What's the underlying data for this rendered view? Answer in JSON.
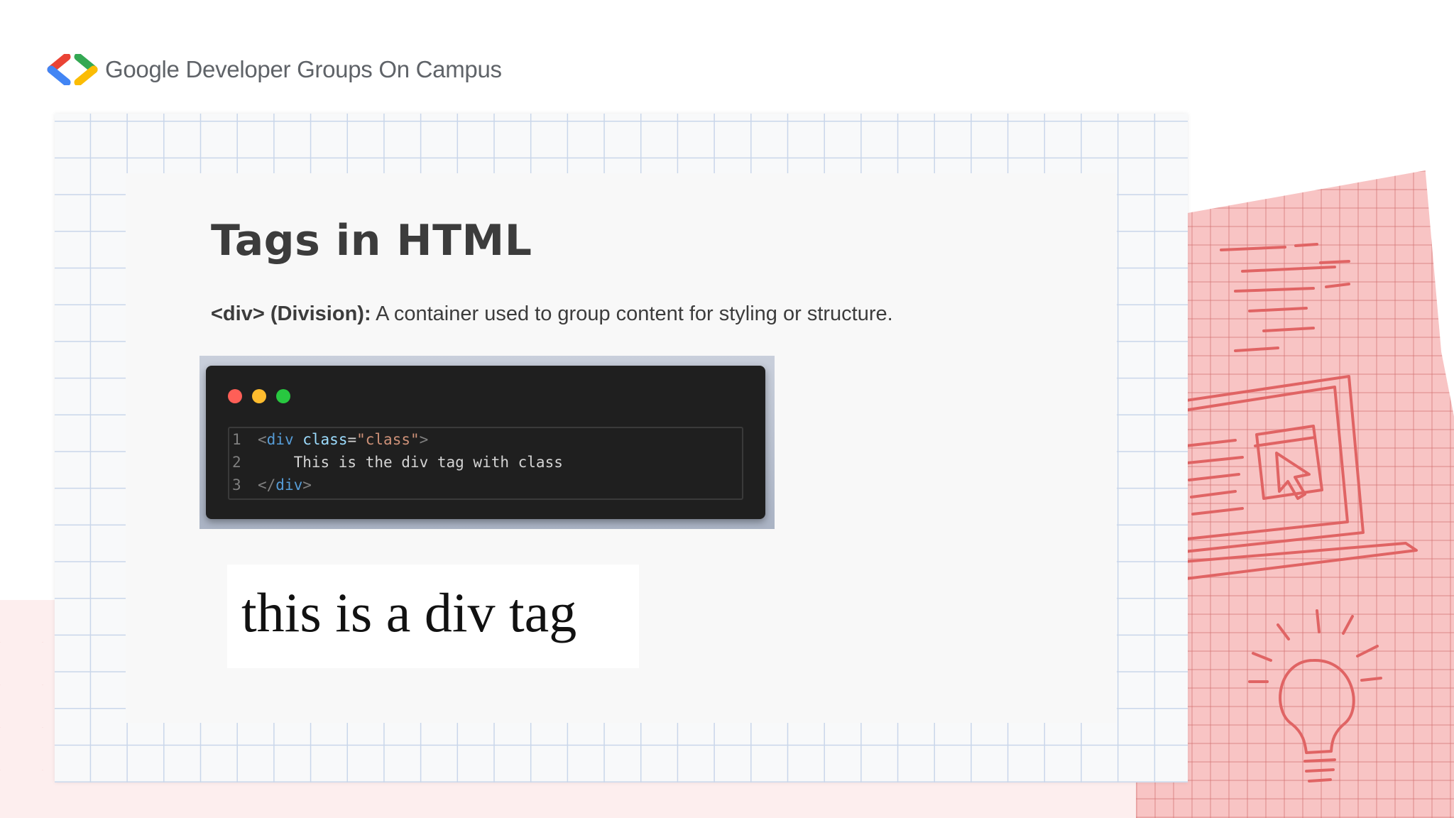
{
  "brand": {
    "name": "Google Developer Groups On Campus",
    "logo_icon": "gdg-brackets-logo",
    "colors": {
      "red": "#ea4335",
      "blue": "#4285f4",
      "green": "#34a853",
      "yellow": "#fbbc04"
    }
  },
  "slide": {
    "title": "Tags in HTML",
    "term": "<div> (Division):",
    "definition": " A container used to group content for styling or structure."
  },
  "code_window": {
    "controls": [
      "close-dot",
      "minimize-dot",
      "maximize-dot"
    ],
    "lines": [
      {
        "number": "1",
        "open": "<",
        "tag": "div",
        "attr": "class",
        "eq": "=",
        "value": "\"class\"",
        "close": ">"
      },
      {
        "number": "2",
        "text": "    This is the div tag with class"
      },
      {
        "number": "3",
        "open": "</",
        "tag": "div",
        "close": ">"
      }
    ]
  },
  "output": {
    "text": "this is a div tag"
  },
  "decoration": {
    "paper_color": "#f8c4c4",
    "sketch_color": "#e06464"
  }
}
